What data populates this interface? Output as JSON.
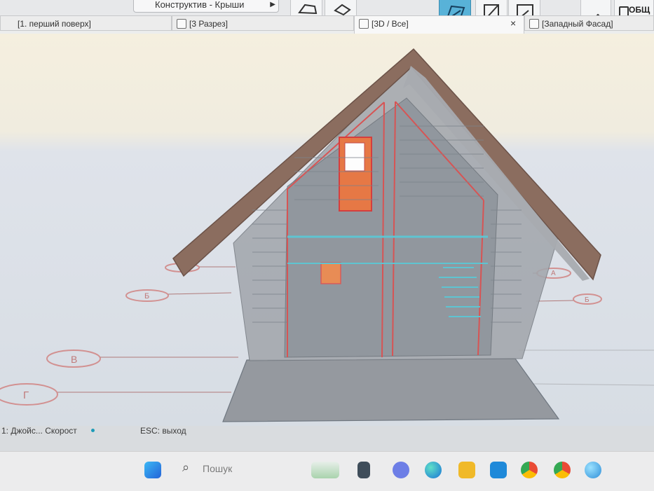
{
  "toolbar": {
    "dropdown_label": "Конструктив - Крыши",
    "right_label": "ОБЩ"
  },
  "tabs": {
    "floor_plan": "[1. перший поверх]",
    "section": "[3 Разрез]",
    "three_d": "[3D / Все]",
    "close": "×",
    "facade": "[Западный Фасад]"
  },
  "grid_labels": [
    "Б",
    "В",
    "Г",
    "А",
    "Б"
  ],
  "status": {
    "left_text": "1: Джойс... Скорост",
    "esc_text": "ESC: выход"
  },
  "taskbar": {
    "search_placeholder": "Пошук"
  },
  "colors": {
    "active_tool": "#58b2d8",
    "roof": "#8a6b5b",
    "wall": "#8e949b",
    "highlight": "#e53b3b"
  }
}
